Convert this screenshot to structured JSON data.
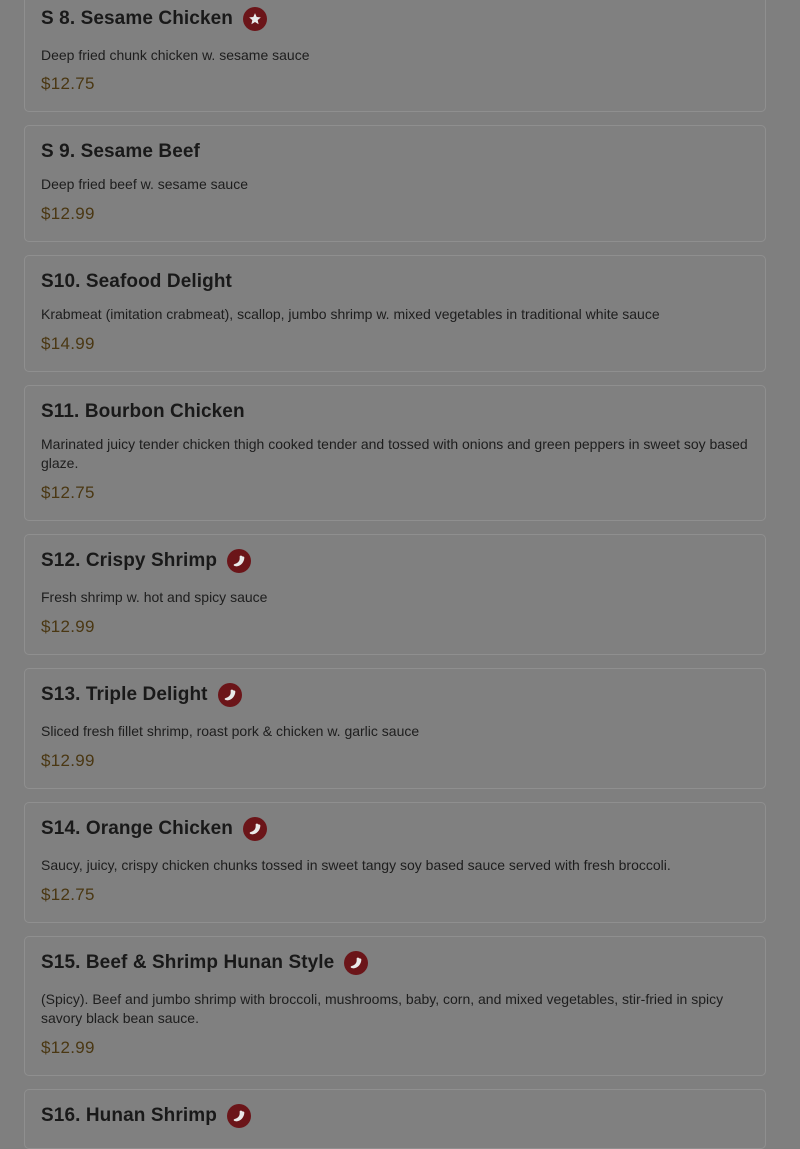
{
  "menu": {
    "items": [
      {
        "name": "S 8. Sesame Chicken",
        "icon": "star-icon",
        "description": "Deep fried chunk chicken w. sesame sauce",
        "price": "$12.75"
      },
      {
        "name": "S 9. Sesame Beef",
        "icon": "",
        "description": "Deep fried beef w. sesame sauce",
        "price": "$12.99"
      },
      {
        "name": "S10. Seafood Delight",
        "icon": "",
        "description": "Krabmeat (imitation crabmeat), scallop, jumbo shrimp w. mixed vegetables in traditional white sauce",
        "price": "$14.99"
      },
      {
        "name": "S11. Bourbon Chicken",
        "icon": "",
        "description": "Marinated juicy tender chicken thigh cooked tender and tossed with onions and green peppers in sweet soy based glaze.",
        "price": "$12.75"
      },
      {
        "name": "S12. Crispy Shrimp",
        "icon": "chili-pepper-icon",
        "description": "Fresh shrimp w. hot and spicy sauce",
        "price": "$12.99"
      },
      {
        "name": "S13. Triple Delight",
        "icon": "chili-pepper-icon",
        "description": "Sliced fresh fillet shrimp, roast pork & chicken w. garlic sauce",
        "price": "$12.99"
      },
      {
        "name": "S14. Orange Chicken",
        "icon": "chili-pepper-icon",
        "description": "Saucy, juicy, crispy chicken chunks tossed in sweet tangy soy based sauce served with fresh broccoli.",
        "price": "$12.75"
      },
      {
        "name": "S15. Beef & Shrimp Hunan Style",
        "icon": "chili-pepper-icon",
        "description": "(Spicy). Beef and jumbo shrimp with broccoli, mushrooms, baby, corn, and mixed vegetables, stir-fried in spicy savory black bean sauce.",
        "price": "$12.99"
      },
      {
        "name": "S16. Hunan Shrimp",
        "icon": "chili-pepper-icon",
        "description": "",
        "price": ""
      }
    ]
  },
  "colors": {
    "overlay": "#7f7f7f",
    "badge": "#6b1519",
    "price": "#4a3712"
  }
}
